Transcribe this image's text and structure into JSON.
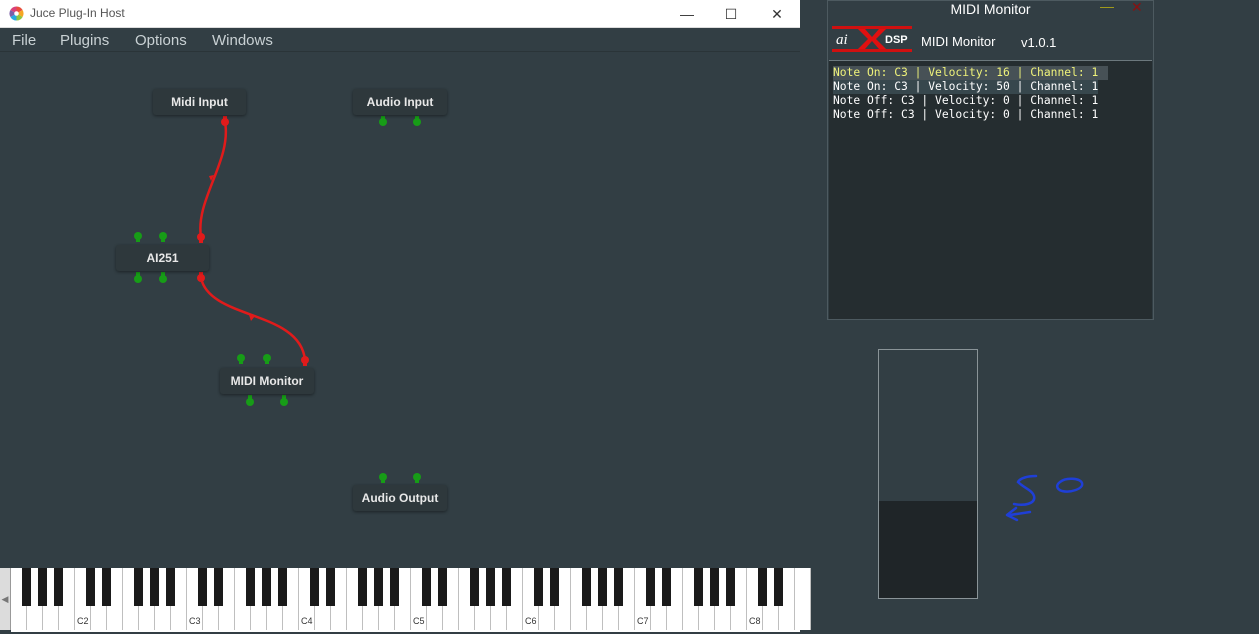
{
  "host": {
    "window_title": "Juce Plug-In Host",
    "controls": {
      "minimize": "—",
      "maximize": "☐",
      "close": "✕"
    },
    "menu": [
      "File",
      "Plugins",
      "Options",
      "Windows"
    ]
  },
  "graph": {
    "nodes": {
      "midi_input": "Midi Input",
      "audio_input": "Audio Input",
      "ai251": "AI251",
      "midi_monitor": "MIDI Monitor",
      "audio_output": "Audio Output"
    },
    "colors": {
      "midi_wire": "#e01b1b",
      "audio_pin": "#179c17"
    }
  },
  "keyboard": {
    "scroll_left_glyph": "◀",
    "octave_labels": [
      "C2",
      "C3",
      "C4",
      "C5",
      "C6",
      "C7",
      "C8"
    ]
  },
  "midi_monitor": {
    "window_title": "MIDI Monitor",
    "minimize_glyph": "—",
    "close_glyph": "✕",
    "logo": {
      "left": "ai",
      "right": "DSP",
      "colors": {
        "bar": "#d01010",
        "x": "#e01010"
      }
    },
    "header_title": "MIDI Monitor",
    "version": "v1.0.1",
    "log": [
      "Note On: C3 | Velocity: 16 | Channel: 1",
      "Note On: C3 | Velocity: 50 | Channel: 1",
      "Note Off: C3 | Velocity: 0 | Channel: 1",
      "Note Off: C3 | Velocity: 0 | Channel: 1"
    ]
  },
  "velocity_meter": {
    "level": 0.39
  },
  "annotation": {
    "text": "50"
  }
}
